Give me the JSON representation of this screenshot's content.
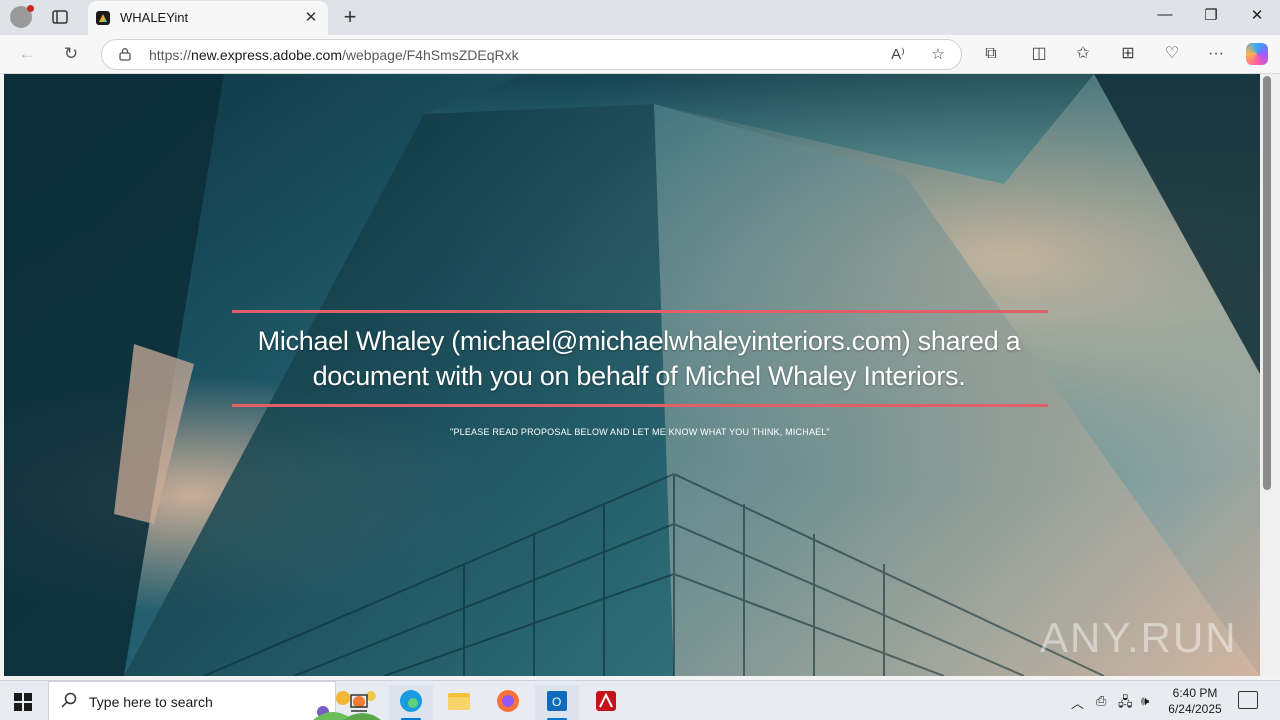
{
  "browser": {
    "tab_title": "WHALEYint",
    "url_prefix": "https://",
    "url_host": "new.express.adobe.com",
    "url_path": "/webpage/F4hSmsZDEqRxk"
  },
  "page": {
    "headline": "Michael Whaley (michael@michaelwhaleyinteriors.com) shared a document with you on behalf of Michel Whaley Interiors.",
    "subline": "\"PLEASE READ PROPOSAL BELOW AND LET ME KNOW WHAT YOU THINK, MICHAEL\"",
    "watermark": "ANY.RUN",
    "accent_color": "#e0606a"
  },
  "taskbar": {
    "search_placeholder": "Type here to search",
    "time": "6:40 PM",
    "date": "6/24/2025"
  },
  "icons": [
    "profile-icon",
    "tab-actions-icon",
    "close-icon",
    "plus-icon",
    "back-icon",
    "refresh-icon",
    "lock-icon",
    "read-aloud-icon",
    "star-icon",
    "extensions-icon",
    "split-screen-icon",
    "favorites-icon",
    "collections-icon",
    "browser-essentials-icon",
    "more-icon",
    "copilot-icon",
    "windows-start-icon",
    "search-icon",
    "task-view-icon",
    "edge-icon",
    "file-explorer-icon",
    "firefox-icon",
    "outlook-icon",
    "acrobat-icon",
    "chevron-up-icon",
    "network-icon",
    "volume-icon",
    "notification-icon"
  ]
}
